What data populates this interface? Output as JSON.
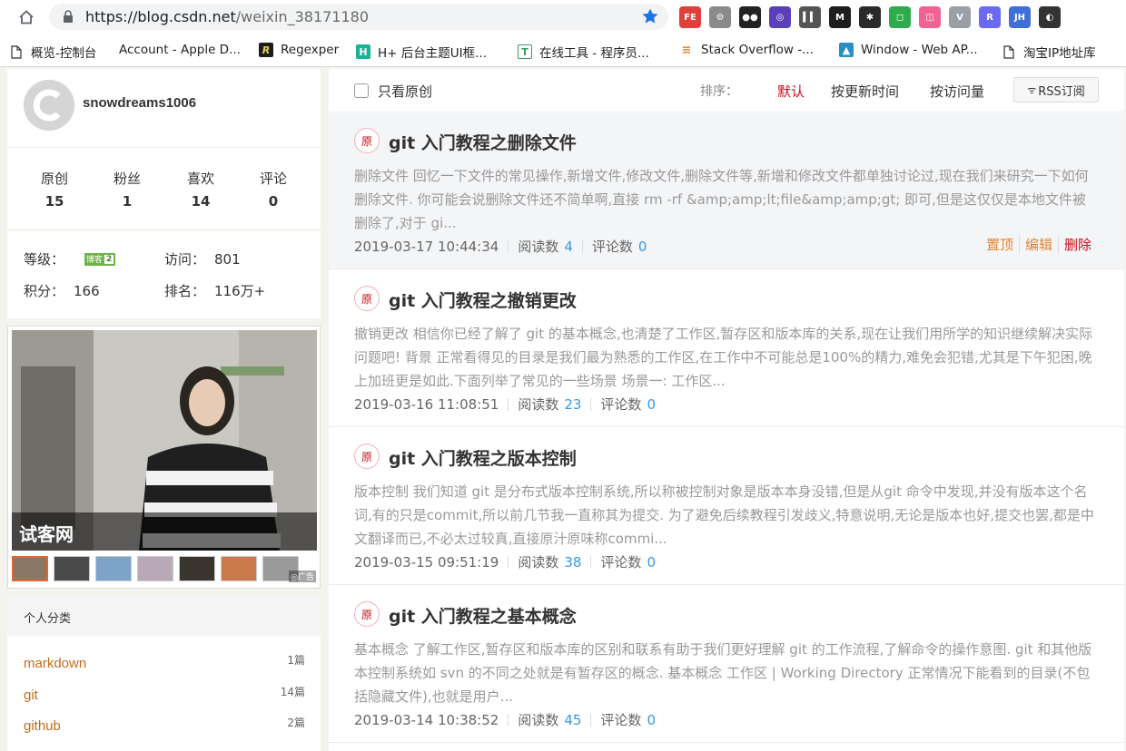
{
  "browser": {
    "url_host": "https://blog.csdn.net",
    "url_path": "/weixin_38171180",
    "extensions": [
      {
        "name": "fe-helper-icon",
        "text": "FE",
        "color": "#e0403a"
      },
      {
        "name": "gear-extension-icon",
        "text": "⚙",
        "color": "#8a8a8a"
      },
      {
        "name": "tampermonkey-icon",
        "text": "●●",
        "color": "#222222"
      },
      {
        "name": "spiral-extension-icon",
        "text": "◎",
        "color": "#5a3fb8"
      },
      {
        "name": "bars-extension-icon",
        "text": "▍▍",
        "color": "#555555"
      },
      {
        "name": "m-extension-icon",
        "text": "M",
        "color": "#1e1e1e"
      },
      {
        "name": "color-picker-icon",
        "text": "✱",
        "color": "#2a2a2a"
      },
      {
        "name": "green-square-icon",
        "text": "◻",
        "color": "#2eab4a"
      },
      {
        "name": "pink-tv-icon",
        "text": "◫",
        "color": "#f06292"
      },
      {
        "name": "vue-devtools-icon",
        "text": "V",
        "color": "#9aa0a6"
      },
      {
        "name": "r-extension-icon",
        "text": "R",
        "color": "#6a6af2"
      },
      {
        "name": "jh-extension-icon",
        "text": "JH",
        "color": "#3f6fd8"
      },
      {
        "name": "recent-extension-icon",
        "text": "◐",
        "color": "#333333"
      }
    ]
  },
  "bookmarks": [
    {
      "label": "概览-控制台",
      "icon": "page-icon"
    },
    {
      "label": "Account - Apple D...",
      "icon": "apple-icon"
    },
    {
      "label": "Regexper",
      "icon": "regexper-icon"
    },
    {
      "label": "H+ 后台主题UI框...",
      "icon": "hplus-icon"
    },
    {
      "label": "在线工具 - 程序员...",
      "icon": "tool-icon"
    },
    {
      "label": "Stack Overflow -...",
      "icon": "stackoverflow-icon"
    },
    {
      "label": "Window - Web AP...",
      "icon": "mdn-icon"
    },
    {
      "label": "淘宝IP地址库",
      "icon": "page-icon"
    }
  ],
  "profile": {
    "username": "snowdreams1006",
    "stats": [
      {
        "label": "原创",
        "value": "15"
      },
      {
        "label": "粉丝",
        "value": "1"
      },
      {
        "label": "喜欢",
        "value": "14"
      },
      {
        "label": "评论",
        "value": "0"
      }
    ],
    "level_label": "等级：",
    "level_badge_text": "博客",
    "level_badge_num": "2",
    "visits_label": "访问：",
    "visits": "801",
    "points_label": "积分：",
    "points": "166",
    "rank_label": "排名：",
    "rank": "116万+"
  },
  "ad": {
    "caption": "试客网",
    "watermark": "◎广告"
  },
  "categories": {
    "title": "个人分类",
    "items": [
      {
        "name": "markdown",
        "count": "1篇"
      },
      {
        "name": "git",
        "count": "14篇"
      },
      {
        "name": "github",
        "count": "2篇"
      }
    ]
  },
  "filter": {
    "only_original": "只看原创",
    "sort_label": "排序：",
    "sort_default": "默认",
    "sort_updated": "按更新时间",
    "sort_views": "按访问量",
    "rss": "RSS订阅"
  },
  "articles": [
    {
      "badge": "原",
      "title": "git 入门教程之删除文件",
      "description": "删除文件 回忆一下文件的常见操作,新增文件,修改文件,删除文件等,新增和修改文件都单独讨论过,现在我们来研究一下如何删除文件. 你可能会说删除文件还不简单啊,直接 rm -rf &amp;amp;lt;file&amp;amp;gt; 即可,但是这仅仅是本地文件被删除了,对于 gi...",
      "date": "2019-03-17 10:44:34",
      "views_label": "阅读数",
      "views": "4",
      "comments_label": "评论数",
      "comments": "0",
      "actions": {
        "pin": "置顶",
        "edit": "编辑",
        "delete": "删除"
      }
    },
    {
      "badge": "原",
      "title": "git 入门教程之撤销更改",
      "description": "撤销更改 相信你已经了解了 git 的基本概念,也清楚了工作区,暂存区和版本库的关系,现在让我们用所学的知识继续解决实际问题吧! 背景 正常看得见的目录是我们最为熟悉的工作区,在工作中不可能总是100%的精力,难免会犯错,尤其是下午犯困,晚上加班更是如此.下面列举了常见的一些场景 场景一: 工作区...",
      "date": "2019-03-16 11:08:51",
      "views_label": "阅读数",
      "views": "23",
      "comments_label": "评论数",
      "comments": "0"
    },
    {
      "badge": "原",
      "title": "git 入门教程之版本控制",
      "description": "版本控制 我们知道 git 是分布式版本控制系统,所以称被控制对象是版本本身没错,但是从git 命令中发现,并没有版本这个名词,有的只是commit,所以前几节我一直称其为提交. 为了避免后续教程引发歧义,特意说明,无论是版本也好,提交也罢,都是中文翻译而已,不必太过较真,直接原汁原味称commi...",
      "date": "2019-03-15 09:51:19",
      "views_label": "阅读数",
      "views": "38",
      "comments_label": "评论数",
      "comments": "0"
    },
    {
      "badge": "原",
      "title": "git 入门教程之基本概念",
      "description": "基本概念 了解工作区,暂存区和版本库的区别和联系有助于我们更好理解 git 的工作流程,了解命令的操作意图. git 和其他版本控制系统如 svn 的不同之处就是有暂存区的概念. 基本概念 工作区 | Working Directory 正常情况下能看到的目录(不包括隐藏文件),也就是用户...",
      "date": "2019-03-14 10:38:52",
      "views_label": "阅读数",
      "views": "45",
      "comments_label": "评论数",
      "comments": "0"
    }
  ],
  "colors": {
    "accent_red": "#ca0c16",
    "category_orange": "#c46c1c",
    "count_blue": "#3399ea",
    "pin_orange": "#e2852e"
  }
}
